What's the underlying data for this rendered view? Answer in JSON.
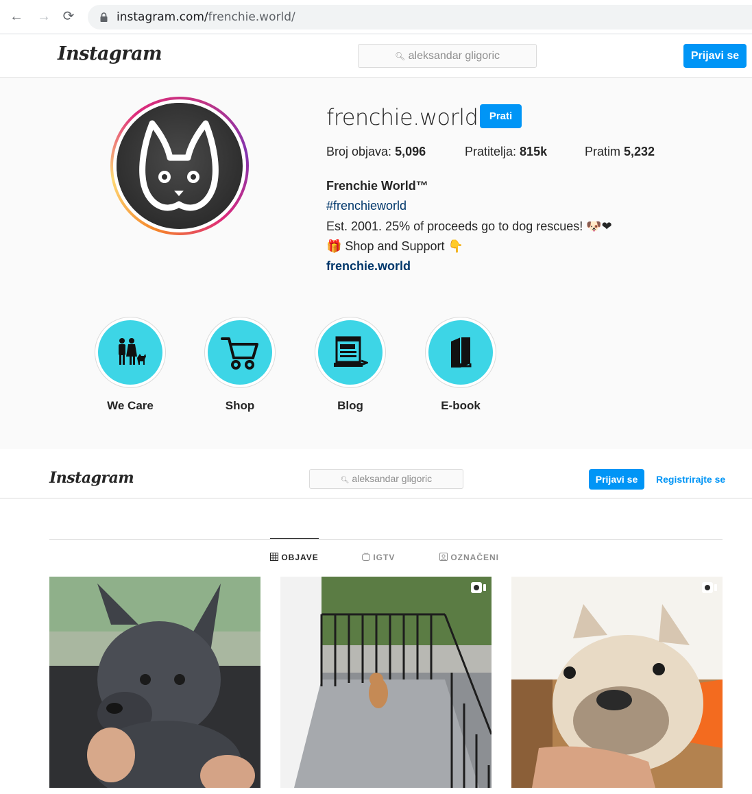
{
  "browser": {
    "url_host": "instagram.com/",
    "url_path": "frenchie.world/"
  },
  "header": {
    "logo": "Instagram",
    "search_placeholder": "aleksandar gligoric",
    "login_label": "Prijavi se",
    "register_label": "Registrirajte se"
  },
  "profile": {
    "username": "frenchie.world",
    "follow_label": "Prati",
    "stats": [
      {
        "label": "Broj objava: ",
        "value": "5,096"
      },
      {
        "label": "Pratitelja: ",
        "value": "815k"
      },
      {
        "label": "Pratim ",
        "value": "5,232"
      }
    ],
    "full_name": "Frenchie World™",
    "hashtag": "#frenchieworld",
    "bio_line1": "Est. 2001. 25% of proceeds go to dog rescues! 🐶❤",
    "bio_line2": "🎁 Shop and Support 👇",
    "website": "frenchie.world"
  },
  "highlights": [
    {
      "label": "We Care",
      "icon": "family-icon"
    },
    {
      "label": "Shop",
      "icon": "cart-icon"
    },
    {
      "label": "Blog",
      "icon": "blog-icon"
    },
    {
      "label": "E-book",
      "icon": "book-icon"
    }
  ],
  "tabs": [
    {
      "label": "OBJAVE",
      "icon": "grid-icon",
      "active": true
    },
    {
      "label": "IGTV",
      "icon": "igtv-icon",
      "active": false
    },
    {
      "label": "OZNAČENI",
      "icon": "tagged-icon",
      "active": false
    }
  ],
  "posts": [
    {
      "subject": "gray french bulldog puppy",
      "video": false
    },
    {
      "subject": "french bulldog on staircase",
      "video": true
    },
    {
      "subject": "cream french bulldog",
      "video": true
    }
  ],
  "colors": {
    "accent": "#0095f6",
    "highlight_bg": "#3dd5e6",
    "link": "#00376b"
  }
}
